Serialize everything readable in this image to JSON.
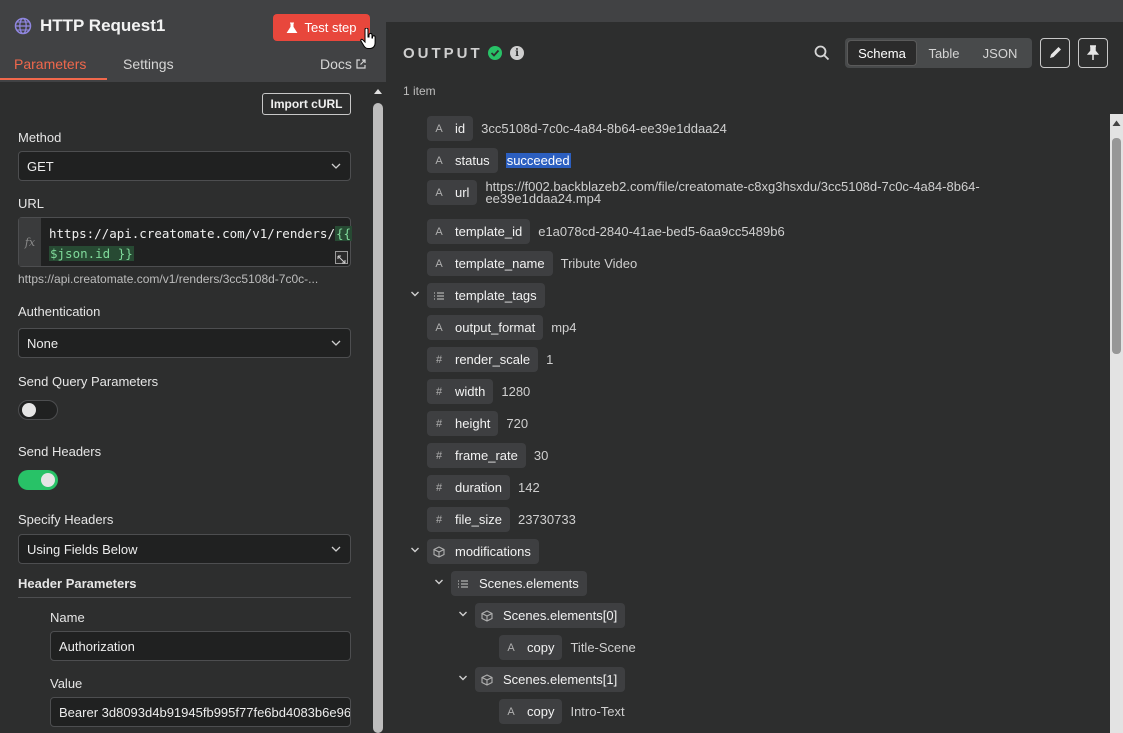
{
  "node": {
    "title": "HTTP Request1",
    "test_step_label": "Test step",
    "tabs": [
      "Parameters",
      "Settings"
    ],
    "docs_label": "Docs"
  },
  "params": {
    "import_curl_label": "Import cURL",
    "method_label": "Method",
    "method_value": "GET",
    "url_label": "URL",
    "url_fx": "fx",
    "url_prefix": "https://api.creatomate.com/v1/renders/",
    "url_expr_open": "{{",
    "url_expr_body": "$json.id }}",
    "url_preview": "https://api.creatomate.com/v1/renders/3cc5108d-7c0c-...",
    "auth_label": "Authentication",
    "auth_value": "None",
    "send_query_label": "Send Query Parameters",
    "send_query_on": false,
    "send_headers_label": "Send Headers",
    "send_headers_on": true,
    "specify_headers_label": "Specify Headers",
    "specify_headers_value": "Using Fields Below",
    "header_params_label": "Header Parameters",
    "name_label": "Name",
    "name_value": "Authorization",
    "value_label": "Value",
    "value_value": "Bearer 3d8093d4b91945fb995f77fe6bd4083b6e96"
  },
  "output": {
    "title": "OUTPUT",
    "item_count": "1 item",
    "view_modes": [
      "Schema",
      "Table",
      "JSON"
    ],
    "active_view": "Schema",
    "rows": [
      {
        "type": "A",
        "key": "id",
        "value": "3cc5108d-7c0c-4a84-8b64-ee39e1ddaa24"
      },
      {
        "type": "A",
        "key": "status",
        "value": "succeeded"
      },
      {
        "type": "A",
        "key": "url",
        "value": "https://f002.backblazeb2.com/file/creatomate-c8xg3hsxdu/3cc5108d-7c0c-4a84-8b64-",
        "value2": "ee39e1ddaa24.mp4"
      },
      {
        "type": "A",
        "key": "template_id",
        "value": "e1a078cd-2840-41ae-bed5-6aa9cc5489b6"
      },
      {
        "type": "A",
        "key": "template_name",
        "value": "Tribute Video"
      },
      {
        "type": "list",
        "key": "template_tags",
        "value": ""
      },
      {
        "type": "A",
        "key": "output_format",
        "value": "mp4"
      },
      {
        "type": "#",
        "key": "render_scale",
        "value": "1"
      },
      {
        "type": "#",
        "key": "width",
        "value": "1280"
      },
      {
        "type": "#",
        "key": "height",
        "value": "720"
      },
      {
        "type": "#",
        "key": "frame_rate",
        "value": "30"
      },
      {
        "type": "#",
        "key": "duration",
        "value": "142"
      },
      {
        "type": "#",
        "key": "file_size",
        "value": "23730733"
      },
      {
        "type": "obj",
        "key": "modifications",
        "value": ""
      },
      {
        "type": "list",
        "key": "Scenes.elements",
        "value": ""
      },
      {
        "type": "obj",
        "key": "Scenes.elements[0]",
        "value": ""
      },
      {
        "type": "A",
        "key": "copy",
        "value": "Title-Scene"
      },
      {
        "type": "obj",
        "key": "Scenes.elements[1]",
        "value": ""
      },
      {
        "type": "A",
        "key": "copy",
        "value": "Intro-Text"
      }
    ]
  },
  "colors": {
    "accent": "#f0684c",
    "test_button": "#e8473c",
    "success": "#28c267",
    "selection": "#2c5fc0"
  }
}
